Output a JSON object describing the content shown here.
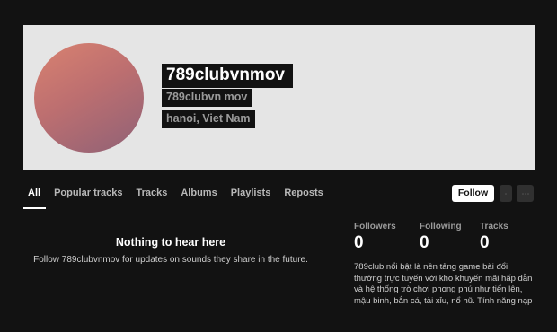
{
  "profile": {
    "display_name": "789clubvnmov",
    "username": "789clubvn mov",
    "location": "hanoi, Viet Nam"
  },
  "tabs": [
    {
      "label": "All"
    },
    {
      "label": "Popular tracks"
    },
    {
      "label": "Tracks"
    },
    {
      "label": "Albums"
    },
    {
      "label": "Playlists"
    },
    {
      "label": "Reposts"
    }
  ],
  "actions": {
    "follow_label": "Follow"
  },
  "empty_state": {
    "title": "Nothing to hear here",
    "message": "Follow 789clubvnmov for updates on sounds they share in the future."
  },
  "stats": {
    "followers_label": "Followers",
    "followers_value": "0",
    "following_label": "Following",
    "following_value": "0",
    "tracks_label": "Tracks",
    "tracks_value": "0"
  },
  "bio": "789club nổi bật là nền tảng game bài đổi thưởng trực tuyến với kho khuyến mãi hấp dẫn và hệ thống trò chơi phong phú như tiến lên, mậu binh, bắn cá, tài xỉu, nổ hũ. Tính năng nạp rút linh hoạt,"
}
